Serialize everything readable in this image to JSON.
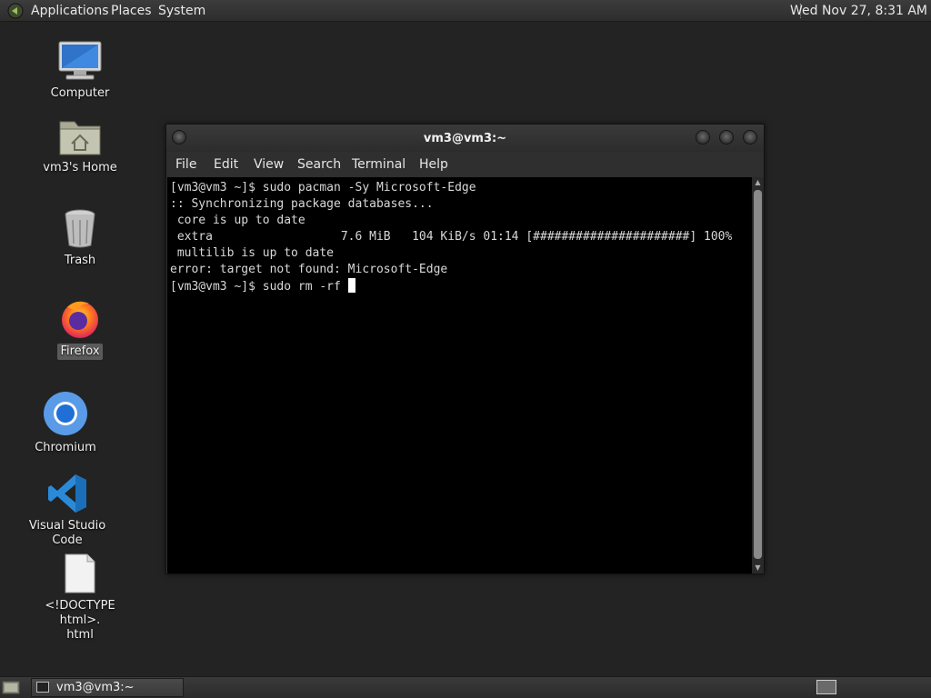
{
  "top_panel": {
    "menus": [
      "Applications",
      "Places",
      "System"
    ],
    "clock": "Wed Nov 27,  8:31 AM"
  },
  "desktop": {
    "icons": [
      {
        "label": "Computer",
        "icon": "computer-icon"
      },
      {
        "label": "vm3's Home",
        "icon": "home-folder-icon"
      },
      {
        "label": "Trash",
        "icon": "trash-icon"
      },
      {
        "label": "Firefox",
        "icon": "firefox-icon"
      },
      {
        "label": "Chromium",
        "icon": "chromium-icon"
      },
      {
        "label": "Visual Studio Code",
        "icon": "vscode-icon"
      },
      {
        "label": "<!DOCTYPE html>.\nhtml",
        "icon": "file-icon"
      }
    ]
  },
  "terminal": {
    "title": "vm3@vm3:~",
    "menus": [
      "File",
      "Edit",
      "View",
      "Search",
      "Terminal",
      "Help"
    ],
    "lines": [
      "[vm3@vm3 ~]$ sudo pacman -Sy Microsoft-Edge",
      ":: Synchronizing package databases...",
      " core is up to date",
      " extra                  7.6 MiB   104 KiB/s 01:14 [######################] 100%",
      " multilib is up to date",
      "error: target not found: Microsoft-Edge",
      "[vm3@vm3 ~]$ sudo rm -rf "
    ]
  },
  "taskbar": {
    "window_label": "vm3@vm3:~"
  },
  "colors": {
    "background": "#232323",
    "terminal_bg": "#000000",
    "terminal_fg": "#d8d8d8"
  }
}
